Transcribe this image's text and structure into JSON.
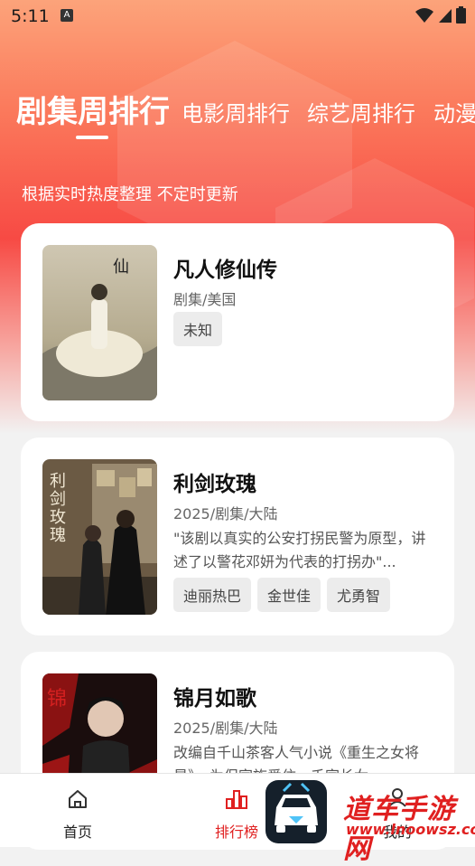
{
  "status_bar": {
    "time": "5:11",
    "notification_icon": "A"
  },
  "tabs": [
    {
      "label": "剧集周排行",
      "active": true
    },
    {
      "label": "电影周排行",
      "active": false
    },
    {
      "label": "综艺周排行",
      "active": false
    },
    {
      "label": "动漫",
      "active": false
    }
  ],
  "subtitle": "根据实时热度整理 不定时更新",
  "items": [
    {
      "title": "凡人修仙传",
      "meta": "剧集/美国",
      "description": "",
      "tags": [
        "未知"
      ],
      "poster_text": "凡人修仙传"
    },
    {
      "title": "利剑玫瑰",
      "meta": "2025/剧集/大陆",
      "description": "\"该剧以真实的公安打拐民警为原型，讲述了以警花邓妍为代表的打拐办\"...",
      "tags": [
        "迪丽热巴",
        "金世佳",
        "尤勇智"
      ],
      "poster_text": "利剑玫瑰"
    },
    {
      "title": "锦月如歌",
      "meta": "2025/剧集/大陆",
      "description": "改编自千山茶客人气小说《重生之女将星》，为保家族爱住，千家长女",
      "tags": [],
      "poster_text": "锦月如歌"
    }
  ],
  "bottom_nav": [
    {
      "label": "首页",
      "icon": "home-icon",
      "active": false
    },
    {
      "label": "排行榜",
      "icon": "chart-icon",
      "active": true
    },
    {
      "label": "我的",
      "icon": "user-icon",
      "active": false
    }
  ],
  "watermark": {
    "text": "道车手游网",
    "url": "www.lnoowsz.com"
  },
  "colors": {
    "accent": "#e02020",
    "gradient_top": "#fca37a",
    "gradient_mid": "#f74a44"
  }
}
